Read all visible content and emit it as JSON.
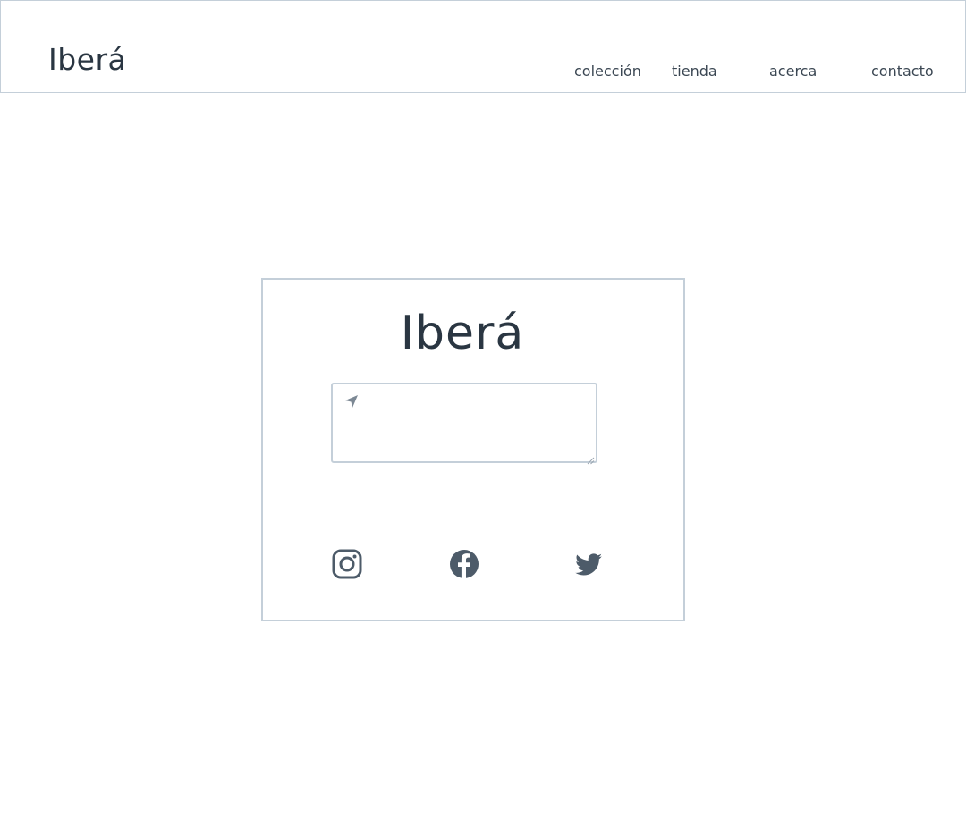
{
  "header": {
    "brand": "Iberá",
    "nav": [
      {
        "label": "colección"
      },
      {
        "label": "tienda"
      },
      {
        "label": "acerca"
      },
      {
        "label": "contacto"
      }
    ]
  },
  "card": {
    "title": "Iberá",
    "message_input": {
      "value": "",
      "icon": "send-icon"
    },
    "social_icons": [
      "instagram-icon",
      "facebook-icon",
      "twitter-icon"
    ]
  },
  "colors": {
    "text": "#2a3642",
    "border": "#c4cfd9",
    "icon": "#4d5b69",
    "background": "#ffffff"
  }
}
